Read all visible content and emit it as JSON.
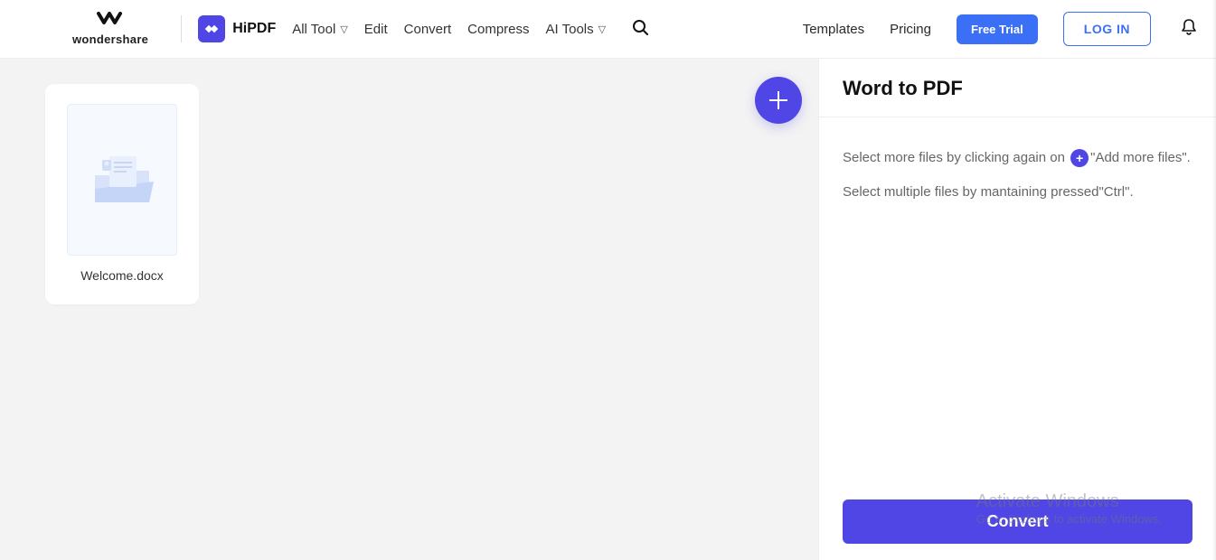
{
  "header": {
    "brand_text": "wondershare",
    "product": "HiPDF",
    "nav": {
      "all_tool": "All Tool",
      "edit": "Edit",
      "convert": "Convert",
      "compress": "Compress",
      "ai_tools": "AI Tools"
    },
    "templates": "Templates",
    "pricing": "Pricing",
    "free_trial": "Free Trial",
    "login": "LOG IN"
  },
  "main": {
    "file_name": "Welcome.docx"
  },
  "side": {
    "title": "Word to PDF",
    "tip_prefix": "Select more files by clicking again on ",
    "tip_suffix": "\"Add more files\".",
    "tip2": "Select multiple files by mantaining pressed\"Ctrl\".",
    "convert": "Convert"
  },
  "watermark": {
    "line1": "Activate Windows",
    "line2": "Go to Settings to activate Windows."
  }
}
